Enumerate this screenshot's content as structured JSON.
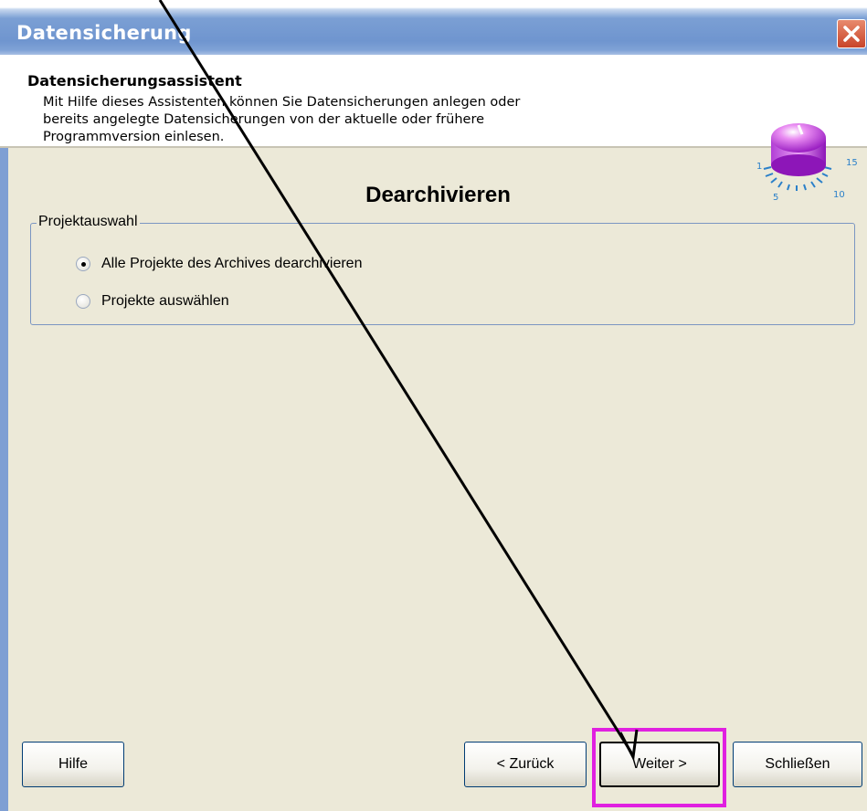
{
  "window": {
    "title": "Datensicherung"
  },
  "header": {
    "title": "Datensicherungsassistent",
    "description_lines": [
      "Mit Hilfe dieses Assistenten können Sie Datensicherungen anlegen oder",
      "bereits angelegte Datensicherungen von der aktuelle oder frühere",
      "Programmversion einlesen."
    ],
    "knob_icon": "volume-knob-icon",
    "knob_scale_labels": [
      "1",
      "15",
      "5",
      "10"
    ]
  },
  "main": {
    "section_heading": "Dearchivieren",
    "group": {
      "legend": "Projektauswahl",
      "options": [
        {
          "label": "Alle Projekte des Archives dearchivieren",
          "selected": true
        },
        {
          "label": "Projekte auswählen",
          "selected": false
        }
      ]
    }
  },
  "footer": {
    "help_label": "Hilfe",
    "back_label": "< Zurück",
    "next_label": "Weiter >",
    "close_label": "Schließen"
  },
  "annotation": {
    "arrow_color": "#000000",
    "highlight_color": "#e020e0",
    "target": "Weiter >"
  },
  "colors": {
    "dialog_background": "#ece9d8",
    "title_bar": "#7b9fd4",
    "close_button": "#c8442a",
    "group_border": "#7b96c2"
  }
}
